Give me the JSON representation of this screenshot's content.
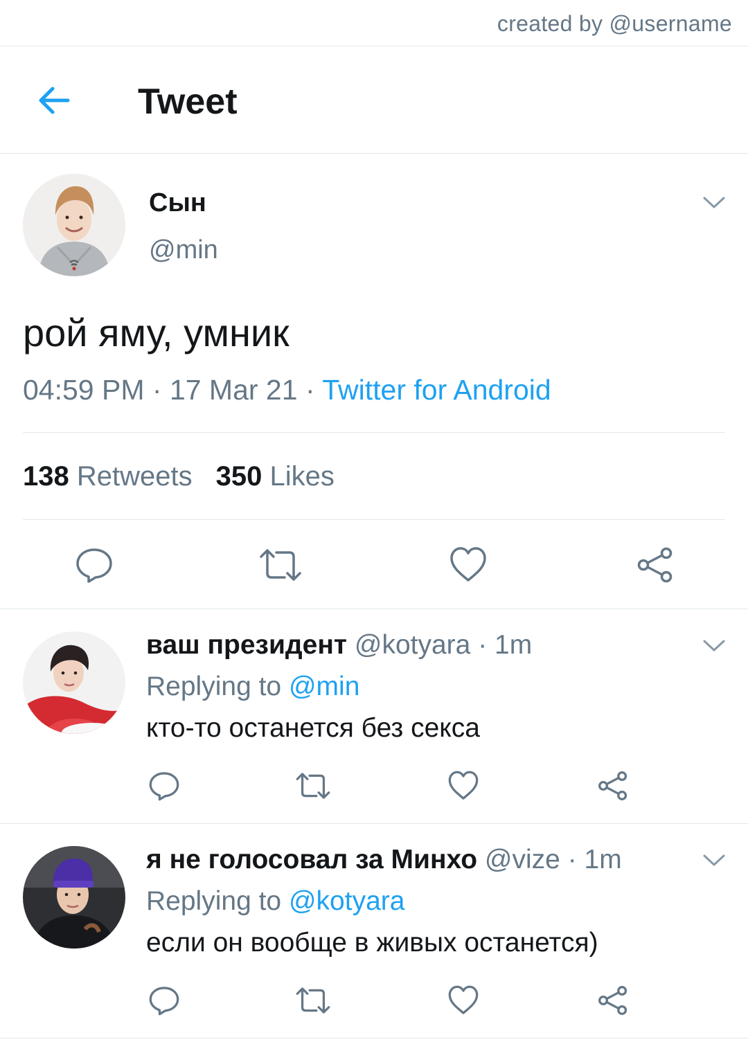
{
  "credit": "created by @username",
  "header": {
    "title": "Tweet"
  },
  "tweet": {
    "author_name": "Сын",
    "author_handle": "@min",
    "text": "рой яму, умник",
    "time": "04:59 PM",
    "sep1": " · ",
    "date": "17 Mar 21",
    "sep2": " · ",
    "source": "Twitter for Android",
    "retweets_count": "138",
    "retweets_label": "Retweets",
    "likes_count": "350",
    "likes_label": "Likes"
  },
  "replies": [
    {
      "name": "ваш президент",
      "handle": "@kotyara",
      "time": " · 1m",
      "replying_label": "Replying to",
      "replying_to": "@min",
      "text": "кто-то останется без секса"
    },
    {
      "name": "я не голосовал за Минхо",
      "handle": "@vize",
      "time": " · 1m",
      "replying_label": "Replying to",
      "replying_to": "@kotyara",
      "text": "если он вообще в живых останется)"
    }
  ],
  "colors": {
    "accent": "#1da1f2",
    "secondary_text": "#657786",
    "primary_text": "#14171a",
    "divider": "#e1e8ed"
  },
  "icons": {
    "back": "arrow-left-icon",
    "more": "chevron-down-icon",
    "reply": "speech-bubble-icon",
    "retweet": "retweet-icon",
    "like": "heart-icon",
    "share": "share-icon"
  }
}
